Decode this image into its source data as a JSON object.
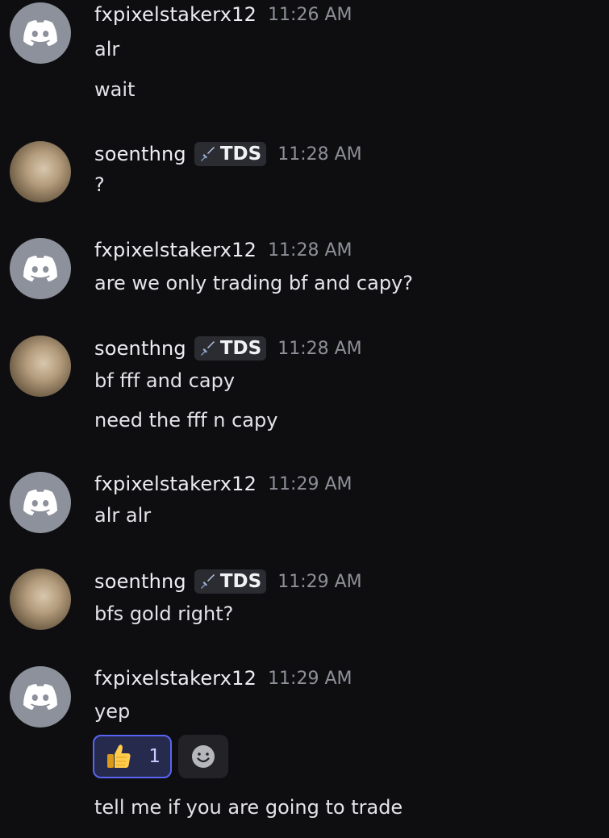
{
  "users": {
    "user_a": "fxpixelstakerx12",
    "user_b": "soenthng",
    "tag_b": "TDS"
  },
  "messages": [
    {
      "time": "11:26 AM",
      "lines": [
        "alr",
        "wait"
      ]
    },
    {
      "time": "11:28 AM",
      "lines": [
        "?"
      ]
    },
    {
      "time": "11:28 AM",
      "lines": [
        "are we only trading bf and capy?"
      ]
    },
    {
      "time": "11:28 AM",
      "lines": [
        "bf fff and capy",
        "need the fff n capy"
      ]
    },
    {
      "time": "11:29 AM",
      "lines": [
        "alr alr"
      ]
    },
    {
      "time": "11:29 AM",
      "lines": [
        "bfs gold right?"
      ]
    },
    {
      "time": "11:29 AM",
      "lines": [
        "yep",
        "tell me if you are going to trade"
      ]
    }
  ],
  "reaction": {
    "emoji": "thumbs-up",
    "count": "1",
    "active_color": "#5865f2"
  },
  "colors": {
    "background": "#0e0e11",
    "timestamp": "#8e9097",
    "discord_avatar": "#8d919b"
  }
}
